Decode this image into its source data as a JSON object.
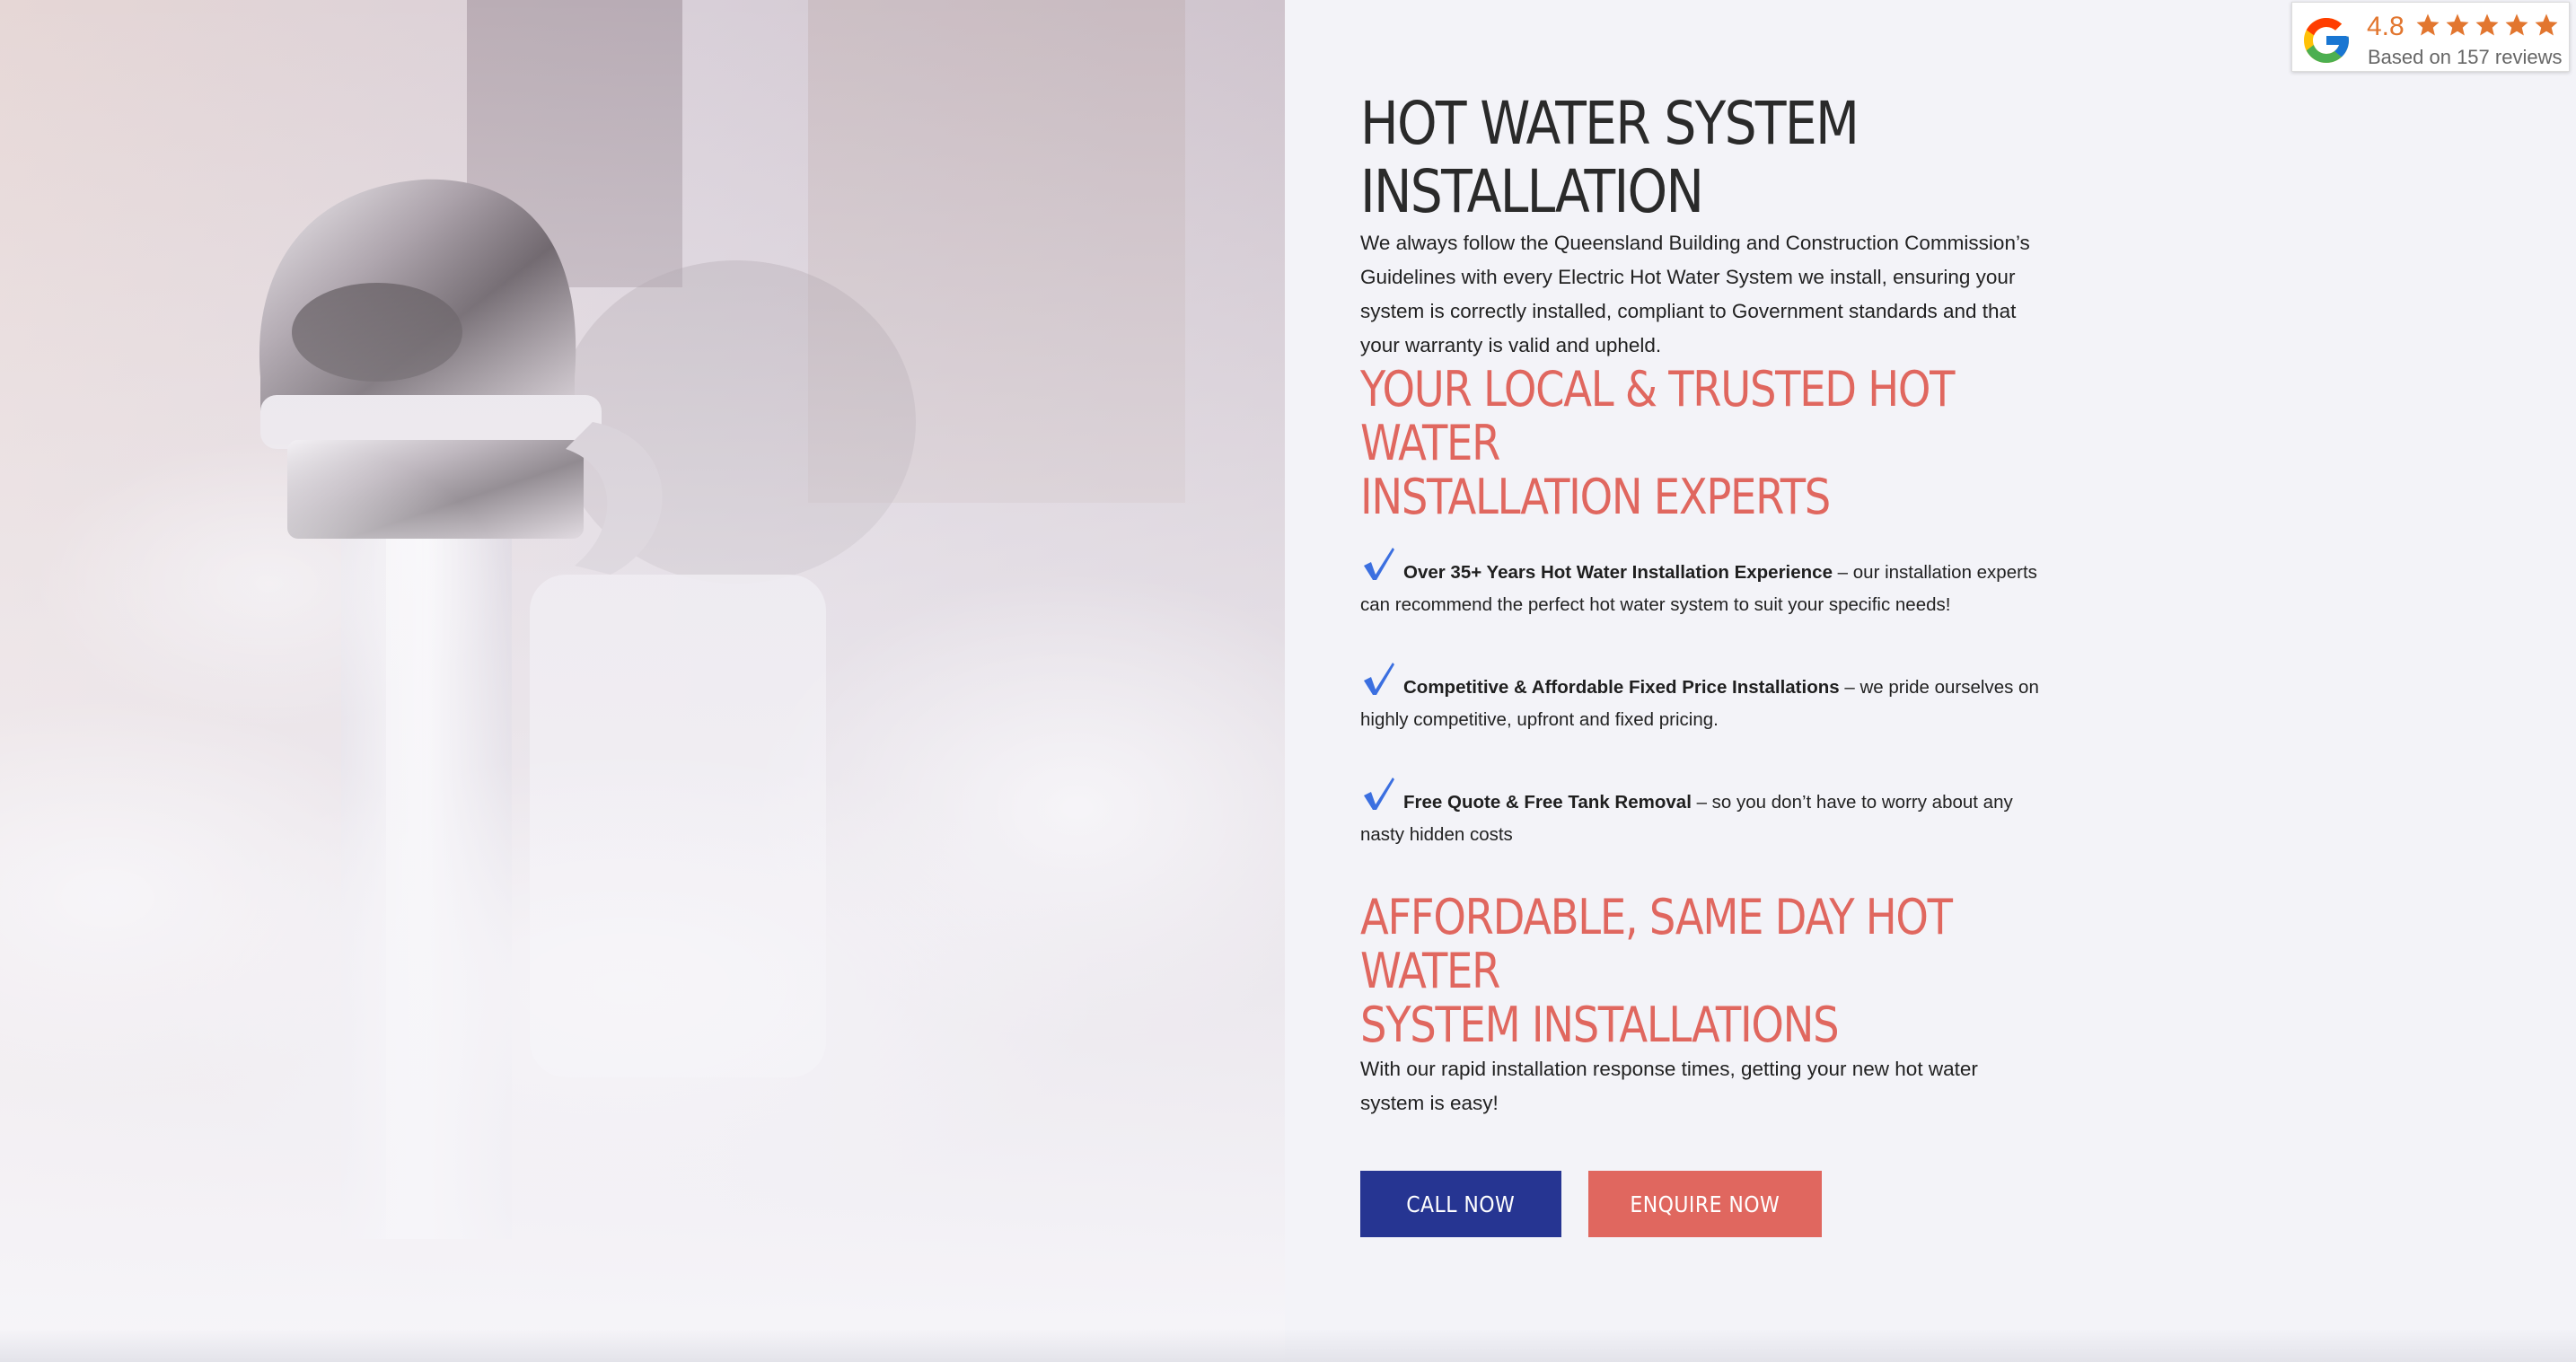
{
  "hero": {
    "image_label": "faucet-with-steam"
  },
  "content": {
    "title_line1": "HOT WATER SYSTEM",
    "title_line2": "INSTALLATION",
    "intro": "We always follow the Queensland Building and Construction Commission’s Guidelines with every Electric Hot Water System we install, ensuring your system is correctly installed, compliant to Government standards and that your warranty is valid and upheld.",
    "section1_line1": "YOUR LOCAL & TRUSTED HOT WATER",
    "section1_line2": "INSTALLATION EXPERTS",
    "features": [
      {
        "bold": "Over 35+ Years Hot Water Installation Experience",
        "text": " – our installation experts can recommend the perfect hot water system to suit your specific needs!"
      },
      {
        "bold": "Competitive & Affordable Fixed Price Installations",
        "text": " – we pride ourselves on highly competitive, upfront and fixed pricing."
      },
      {
        "bold": "Free Quote & Free Tank Removal",
        "text": " – so you don’t have to worry about any nasty hidden costs"
      }
    ],
    "section2_line1": "AFFORDABLE, SAME DAY HOT WATER",
    "section2_line2": "SYSTEM INSTALLATIONS",
    "outro": "With our rapid installation response times, getting your new hot water system is easy!",
    "buttons": {
      "call": "CALL NOW",
      "enquire": "ENQUIRE NOW"
    }
  },
  "badge": {
    "rating": "4.8",
    "stars": 5,
    "reviews_text": "Based on 157 reviews"
  },
  "colors": {
    "accent_red": "#e0675f",
    "button_blue": "#263592",
    "check_blue": "#3b6fe0",
    "star_orange": "#e2762f"
  }
}
